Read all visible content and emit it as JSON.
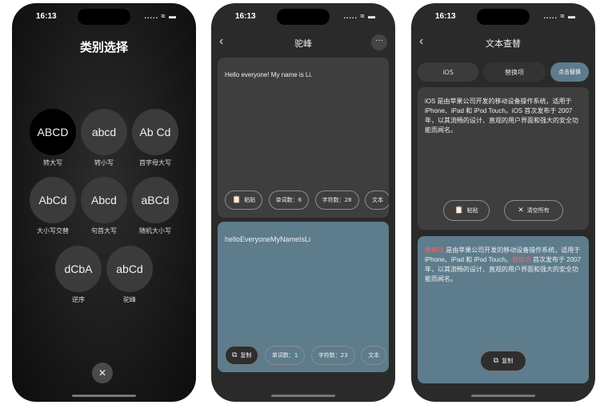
{
  "status": {
    "time": "16:13",
    "signal": "..... ≈ ▬"
  },
  "screen1": {
    "title": "类别选择",
    "options": [
      {
        "sample": "ABCD",
        "label": "转大写"
      },
      {
        "sample": "abcd",
        "label": "转小写"
      },
      {
        "sample": "Ab Cd",
        "label": "首字母大写"
      },
      {
        "sample": "AbCd",
        "label": "大小写交替"
      },
      {
        "sample": "Abcd",
        "label": "句首大写"
      },
      {
        "sample": "aBCd",
        "label": "随机大小写"
      },
      {
        "sample": "dCbA",
        "label": "逆序"
      },
      {
        "sample": "abCd",
        "label": "驼峰"
      }
    ],
    "close_icon": "✕"
  },
  "screen2": {
    "title": "驼峰",
    "back_icon": "‹",
    "more_icon": "···",
    "input_text": "Hello everyone! My name is Li.",
    "input_chips": {
      "paste": "粘贴",
      "word_count": "单词数：6",
      "char_count": "字符数：28",
      "more": "文本"
    },
    "output_text": "helloEveryoneMyNameIsLi",
    "output_chips": {
      "copy": "复制",
      "word_count": "单词数：1",
      "char_count": "字符数：23",
      "more": "文本"
    }
  },
  "screen3": {
    "title": "文本查替",
    "back_icon": "‹",
    "tabs": {
      "find": "iOS",
      "replace": "替换项",
      "action": "点击替换"
    },
    "input_text": "iOS 是由苹果公司开发的移动设备操作系统，适用于 iPhone、iPad 和 iPod Touch。iOS 首次发布于 2007年，以其流畅的设计、直观的用户界面和强大的安全功能而闻名。",
    "paste": "粘贴",
    "clear": "清空所有",
    "output": {
      "part1": "是由苹果公司开发的移动设备操作系统，适用于 iPhone、iPad 和 iPod Touch。",
      "part2": "首次发布于 2007年，以其流畅的设计、直观的用户界面和强大的安全功能而闻名。",
      "highlight": "替换项"
    },
    "copy": "复制"
  },
  "colors": {
    "accent": "#5d7c8c",
    "card": "#3e3e3e",
    "highlight": "#e06a6a"
  }
}
